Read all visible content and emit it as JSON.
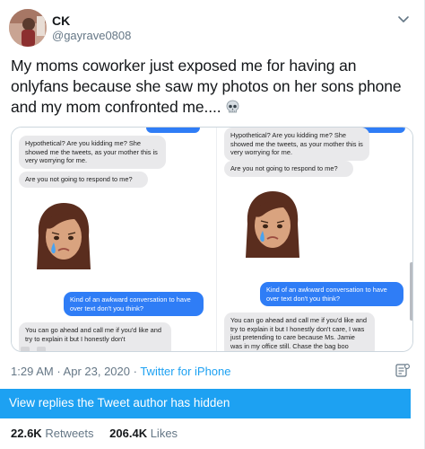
{
  "author": {
    "name": "CK",
    "handle": "@gayrave0808"
  },
  "tweet": {
    "text": "My moms coworker just exposed me for having an onlyfans because she saw my photos on her sons phone and my mom confronted me....",
    "emoji": "skull-icon"
  },
  "photo": {
    "left": {
      "msg1": "Hypothetical? Are you kidding me? She showed me the tweets, as your mother this is very worrying for me.",
      "msg2": "Are you not going to respond to me?",
      "reply": "Kind of an awkward conversation to have over text don't you think?",
      "msg3": "You can go ahead and call me if you'd like and try to explain it but I honestly don't"
    },
    "right": {
      "msg1": "Hypothetical? Are you kidding me? She showed me the tweets, as your mother this is very worrying for me.",
      "msg2": "Are you not going to respond to me?",
      "reply": "Kind of an awkward conversation to have over text don't you think?",
      "msg3": "You can go ahead and call me if you'd like and try to explain it but I honestly don't care, I was just pretending to care because Ms. Jamie was in my office still. Chase the bag boo"
    }
  },
  "meta": {
    "time": "1:29 AM",
    "separator": " · ",
    "date": "Apr 23, 2020",
    "source": "Twitter for iPhone"
  },
  "hidden_replies_label": "View replies the Tweet author has hidden",
  "stats": {
    "retweets_count": "22.6K",
    "retweets_label": "Retweets",
    "likes_count": "206.4K",
    "likes_label": "Likes"
  },
  "colors": {
    "accent": "#1da1f2",
    "imessage_blue": "#2f7df6",
    "muted": "#657786"
  }
}
